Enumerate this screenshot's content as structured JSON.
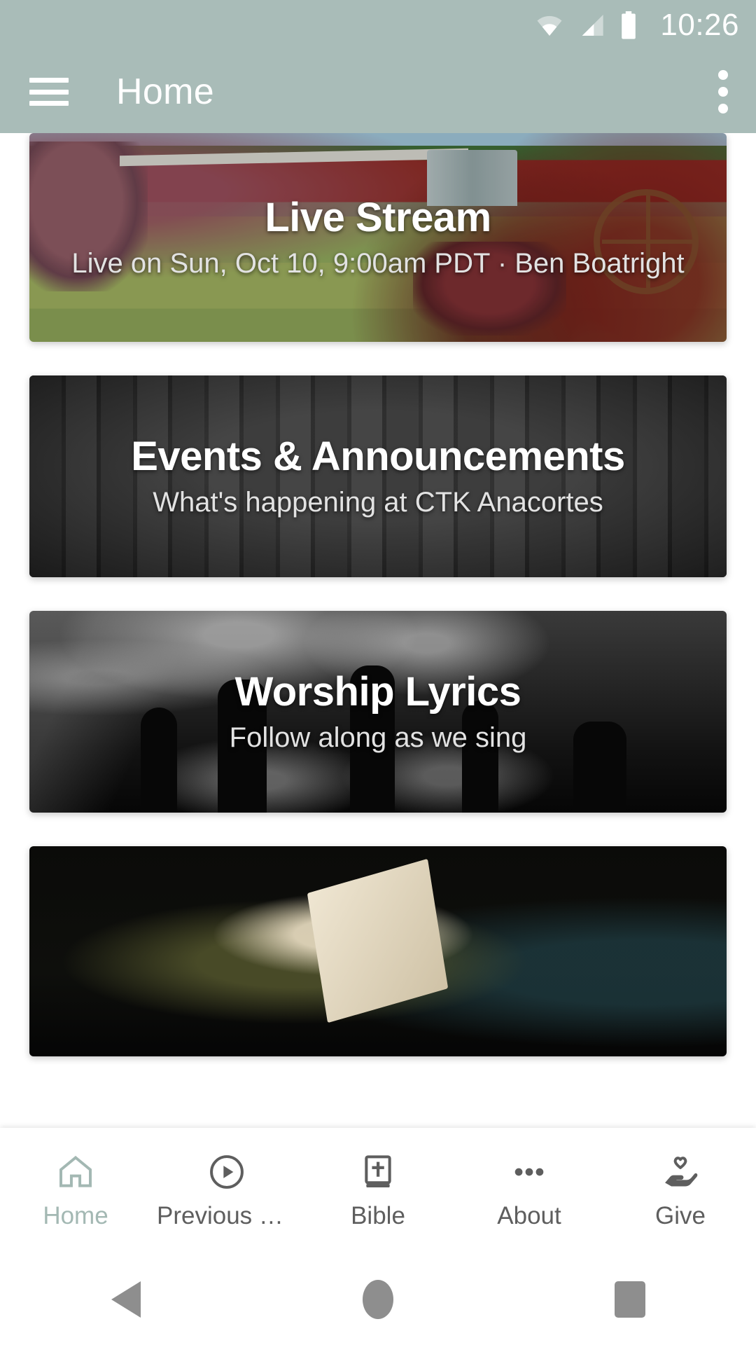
{
  "status_bar": {
    "time": "10:26",
    "wifi_icon": "wifi-icon",
    "signal_icon": "cellular-signal-icon",
    "battery_icon": "battery-full-icon",
    "background_color": "#a9bcb8",
    "foreground_color": "#ffffff"
  },
  "app_bar": {
    "menu_icon": "hamburger-menu-icon",
    "title": "Home",
    "overflow_icon": "more-vertical-icon",
    "background_color": "#a9bcb8"
  },
  "cards": [
    {
      "id": "live-stream",
      "title": "Live Stream",
      "subtitle": "Live on Sun, Oct 10, 9:00am PDT · Ben Boatright",
      "image_description": "red-barn-farm-photo"
    },
    {
      "id": "events-announcements",
      "title": "Events & Announcements",
      "subtitle": "What's happening at CTK Anacortes",
      "image_description": "dark-wood-planks-photo"
    },
    {
      "id": "worship-lyrics",
      "title": "Worship Lyrics",
      "subtitle": "Follow along as we sing",
      "image_description": "worship-crowd-raised-hands-photo"
    },
    {
      "id": "bible-reading",
      "title": "",
      "subtitle": "",
      "image_description": "person-reading-bible-photo"
    }
  ],
  "bottom_nav": {
    "active_color": "#a3b8b3",
    "inactive_color": "#5e5e5e",
    "items": [
      {
        "label": "Home",
        "icon": "home-icon",
        "active": true
      },
      {
        "label": "Previous Se…",
        "icon": "play-circle-icon",
        "active": false
      },
      {
        "label": "Bible",
        "icon": "bible-book-icon",
        "active": false
      },
      {
        "label": "About",
        "icon": "more-horizontal-icon",
        "active": false
      },
      {
        "label": "Give",
        "icon": "hand-heart-icon",
        "active": false
      }
    ]
  },
  "system_nav": {
    "back_label": "back-button",
    "home_label": "home-button",
    "recents_label": "recents-button"
  }
}
